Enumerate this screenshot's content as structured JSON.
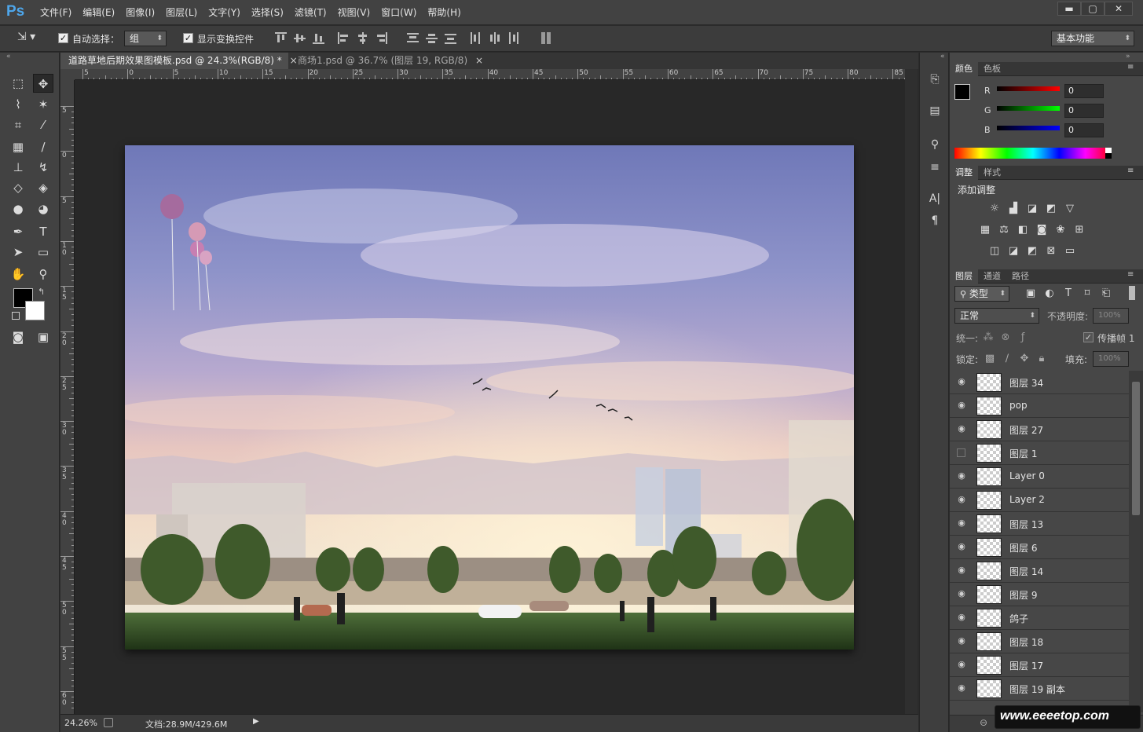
{
  "app": {
    "logo": "Ps"
  },
  "menu": [
    "文件(F)",
    "编辑(E)",
    "图像(I)",
    "图层(L)",
    "文字(Y)",
    "选择(S)",
    "滤镜(T)",
    "视图(V)",
    "窗口(W)",
    "帮助(H)"
  ],
  "window_controls": {
    "minimize": "▬",
    "maximize": "▢",
    "close": "✕"
  },
  "options": {
    "auto_select_label": "自动选择：",
    "auto_select_value": "组",
    "show_transform_label": "显示变换控件",
    "workspace": "基本功能"
  },
  "tabs": [
    {
      "title": "道路草地后期效果图模板.psd @ 24.3%(RGB/8) *",
      "close": "×"
    },
    {
      "title": "商场1.psd @ 36.7% (图层 19, RGB/8)",
      "close": "×"
    }
  ],
  "ruler": {
    "h_labels": [
      "5",
      "0",
      "5",
      "10",
      "15",
      "20",
      "25",
      "30",
      "35",
      "40",
      "45",
      "50",
      "55",
      "60",
      "65",
      "70",
      "75",
      "80",
      "85"
    ],
    "v_labels": [
      "5",
      "0",
      "5",
      "10",
      "15",
      "20",
      "25",
      "30",
      "35",
      "40",
      "45",
      "50",
      "55",
      "60"
    ]
  },
  "status": {
    "zoom": "24.26%",
    "doc": "文档:28.9M/429.6M"
  },
  "color_panel": {
    "tabs": [
      "颜色",
      "色板"
    ],
    "channels": [
      {
        "label": "R",
        "value": "0",
        "color": "#ff0000"
      },
      {
        "label": "G",
        "value": "0",
        "color": "#00ff00"
      },
      {
        "label": "B",
        "value": "0",
        "color": "#0000ff"
      }
    ]
  },
  "adjust_panel": {
    "tabs": [
      "调整",
      "样式"
    ],
    "title": "添加调整"
  },
  "layers_panel": {
    "tabs": [
      "图层",
      "通道",
      "路径"
    ],
    "filter_kind": "类型",
    "blend_mode": "正常",
    "opacity_label": "不透明度:",
    "opacity_value": "100%",
    "unify_label": "统一:",
    "propagate_label": "传播帧 1",
    "lock_label": "锁定:",
    "fill_label": "填充:",
    "fill_value": "100%",
    "layers": [
      {
        "name": "图层 34",
        "visible": true
      },
      {
        "name": "pop",
        "visible": true
      },
      {
        "name": "图层 27",
        "visible": true
      },
      {
        "name": "图层 1",
        "visible": false
      },
      {
        "name": "Layer 0",
        "visible": true
      },
      {
        "name": "Layer 2",
        "visible": true
      },
      {
        "name": "图层 13",
        "visible": true
      },
      {
        "name": "图层 6",
        "visible": true
      },
      {
        "name": "图层 14",
        "visible": true
      },
      {
        "name": "图层 9",
        "visible": true
      },
      {
        "name": "鸽子",
        "visible": true
      },
      {
        "name": "图层 18",
        "visible": true
      },
      {
        "name": "图层 17",
        "visible": true
      },
      {
        "name": "图层 19 副本",
        "visible": true
      }
    ]
  },
  "watermark": "www.eeeetop.com"
}
